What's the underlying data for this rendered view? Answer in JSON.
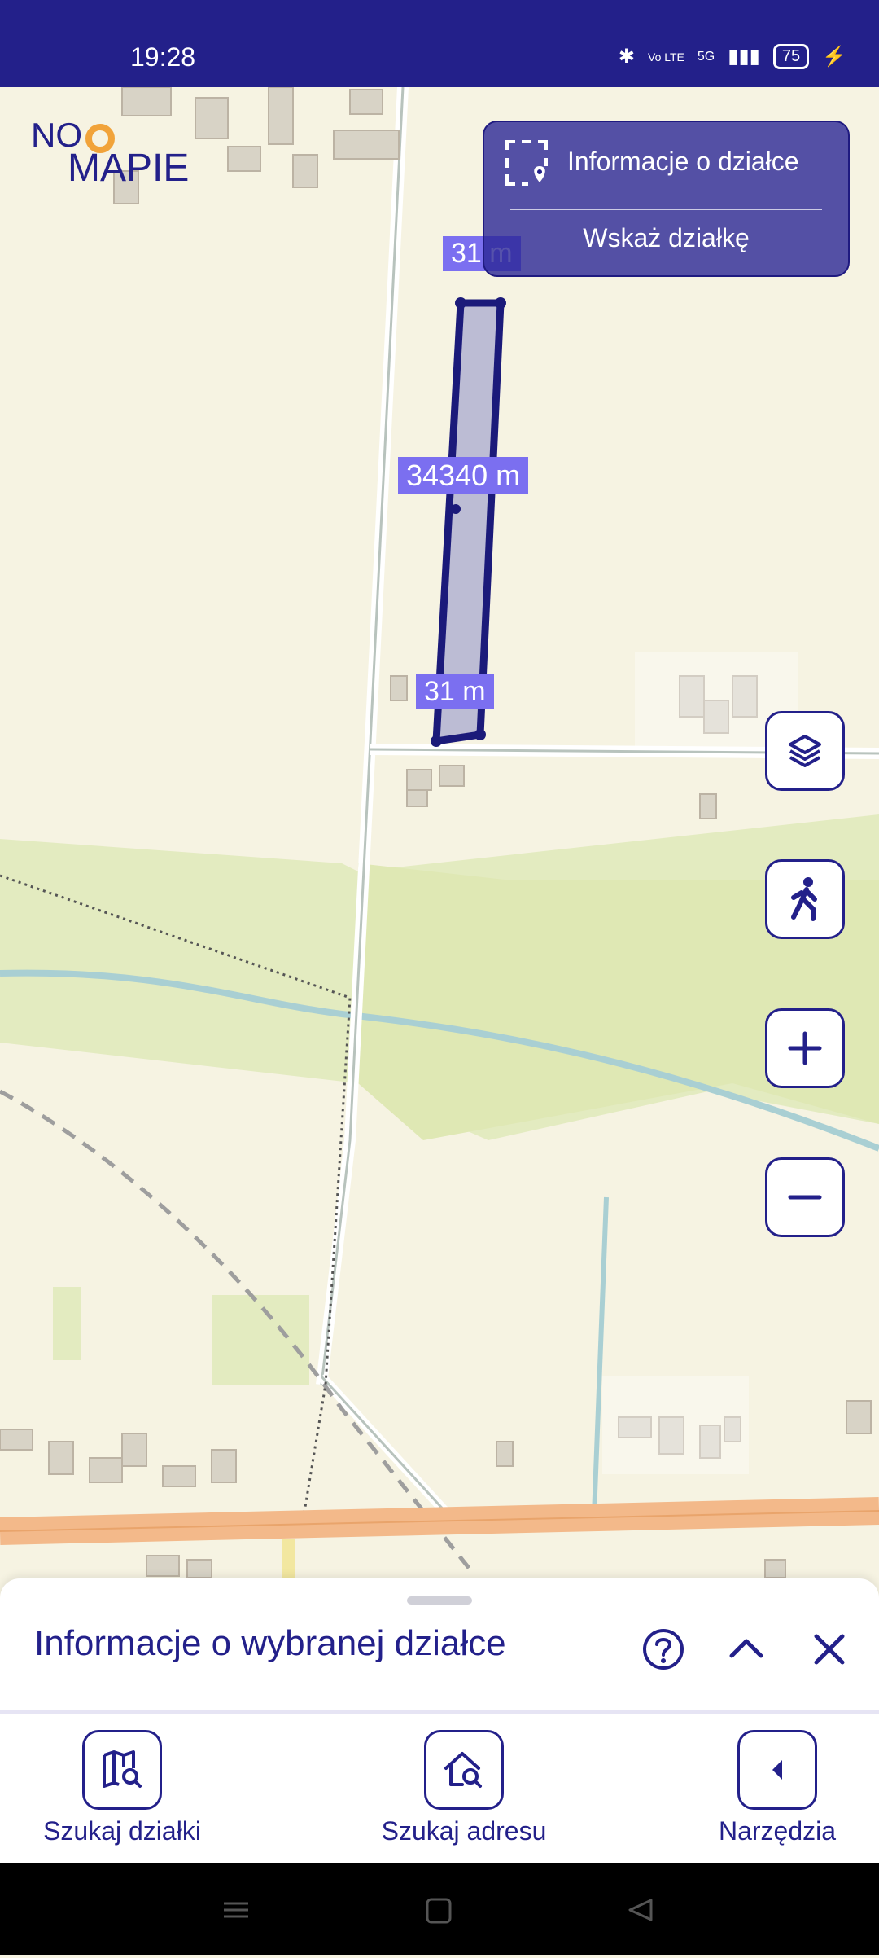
{
  "status_bar": {
    "time": "19:28",
    "network_5g": "5G",
    "volte": "Vo LTE",
    "battery": "75"
  },
  "logo": {
    "line1": "NO",
    "line2": "MAPIE"
  },
  "info_panel": {
    "parcel_info_label": "Informacje o działce",
    "select_parcel_label": "Wskaż działkę"
  },
  "measurements": {
    "top_label": "31 m",
    "side_label_hidden": "34",
    "side_label": "340 m",
    "bottom_label": "31 m"
  },
  "map_controls": [
    "layers-icon",
    "walking-person-icon",
    "plus-icon",
    "minus-icon"
  ],
  "sheet": {
    "title": "Informacje o wybranej działce"
  },
  "bottom_nav": {
    "items": [
      {
        "label": "Szukaj działki",
        "icon": "map-search-icon"
      },
      {
        "label": "Szukaj adresu",
        "icon": "home-search-icon"
      },
      {
        "label": "Narzędzia",
        "icon": "chevron-left-icon"
      }
    ]
  },
  "colors": {
    "brand": "#23208a",
    "accent": "#f1a33a",
    "parcel_outline": "#1b1a7a",
    "label_bg": "#7b6ff0"
  }
}
